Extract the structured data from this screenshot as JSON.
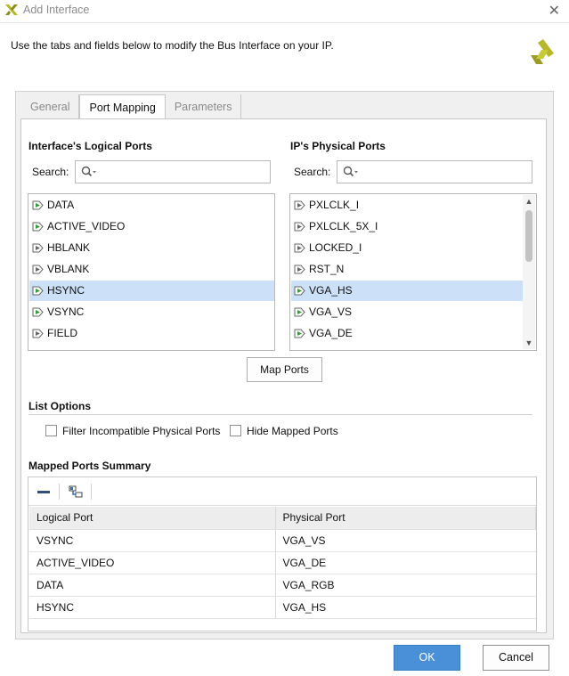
{
  "window": {
    "title": "Add Interface",
    "close_glyph": "✕"
  },
  "description": "Use the tabs and fields below to modify the Bus Interface on your IP.",
  "tabs": [
    {
      "label": "General",
      "active": false
    },
    {
      "label": "Port Mapping",
      "active": true
    },
    {
      "label": "Parameters",
      "active": false
    }
  ],
  "logical_ports": {
    "title": "Interface's Logical Ports",
    "search_label": "Search:",
    "search_value": "",
    "items": [
      {
        "label": "DATA",
        "mapped": true,
        "selected": false
      },
      {
        "label": "ACTIVE_VIDEO",
        "mapped": true,
        "selected": false
      },
      {
        "label": "HBLANK",
        "mapped": false,
        "selected": false
      },
      {
        "label": "VBLANK",
        "mapped": false,
        "selected": false
      },
      {
        "label": "HSYNC",
        "mapped": true,
        "selected": true
      },
      {
        "label": "VSYNC",
        "mapped": true,
        "selected": false
      },
      {
        "label": "FIELD",
        "mapped": false,
        "selected": false
      }
    ]
  },
  "physical_ports": {
    "title": "IP's Physical Ports",
    "search_label": "Search:",
    "search_value": "",
    "items": [
      {
        "label": "PXLCLK_I",
        "mapped": false,
        "selected": false
      },
      {
        "label": "PXLCLK_5X_I",
        "mapped": false,
        "selected": false
      },
      {
        "label": "LOCKED_I",
        "mapped": false,
        "selected": false
      },
      {
        "label": "RST_N",
        "mapped": false,
        "selected": false
      },
      {
        "label": "VGA_HS",
        "mapped": true,
        "selected": true
      },
      {
        "label": "VGA_VS",
        "mapped": true,
        "selected": false
      },
      {
        "label": "VGA_DE",
        "mapped": true,
        "selected": false
      }
    ]
  },
  "map_ports_button": "Map Ports",
  "list_options": {
    "title": "List Options",
    "filter_incompatible": {
      "label": "Filter Incompatible Physical Ports",
      "checked": false
    },
    "hide_mapped": {
      "label": "Hide Mapped Ports",
      "checked": false
    }
  },
  "summary": {
    "title": "Mapped Ports Summary",
    "columns": [
      "Logical Port",
      "Physical Port"
    ],
    "rows": [
      [
        "VSYNC",
        "VGA_VS"
      ],
      [
        "ACTIVE_VIDEO",
        "VGA_DE"
      ],
      [
        "DATA",
        "VGA_RGB"
      ],
      [
        "HSYNC",
        "VGA_HS"
      ]
    ]
  },
  "buttons": {
    "ok": "OK",
    "cancel": "Cancel"
  },
  "colors": {
    "selection": "#cce0f7",
    "ok_button": "#4a90d9",
    "mapped_pin": "#3a9a3a",
    "unmapped_pin": "#666666",
    "logo": "#b5b82d"
  },
  "icons": {
    "app": "xilinx-logo-icon",
    "search": "search-icon",
    "mapped_port": "mapped-port-pin-icon",
    "unmapped_port": "port-pin-icon",
    "remove": "remove-icon",
    "auto_connect": "auto-connect-icon"
  }
}
